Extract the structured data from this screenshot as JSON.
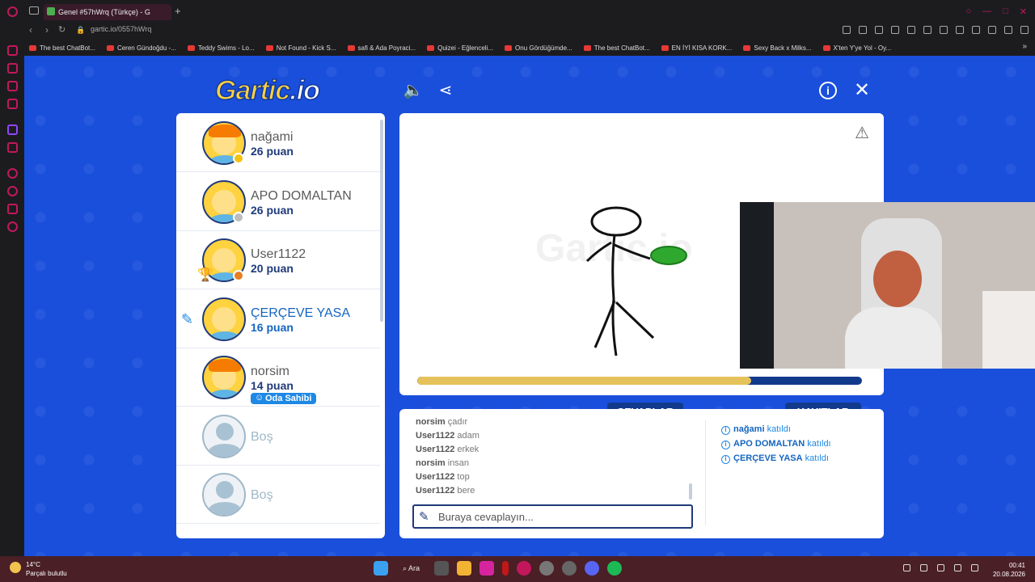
{
  "browser": {
    "tab_title": "Genel #57hWrq (Türkçe) - G",
    "url": "gartic.io/0557hWrq",
    "new_tab": "+",
    "bookmarks": [
      "The best ChatBot...",
      "Ceren Gündoğdu -...",
      "Teddy Swims - Lo...",
      "Not Found - Kick S...",
      "safi & Ada Poyraci...",
      "Quizei - Eğlenceli...",
      "Onu Gördüğümde...",
      "The best ChatBot...",
      "EN İYİ KISA KORK...",
      "Sexy Back x Milks...",
      "X'ten Y'ye Yol - Oy..."
    ]
  },
  "game": {
    "logo": "Gartic",
    "logo_suffix": ".io",
    "players": [
      {
        "name": "nağami",
        "points": "26 puan",
        "dot_color": "#f4c20d"
      },
      {
        "name": "APO DOMALTAN",
        "points": "26 puan",
        "dot_color": "#bdbdbd"
      },
      {
        "name": "User1122",
        "points": "20 puan",
        "dot_color": "#e67e22"
      },
      {
        "name": "ÇERÇEVE YASA",
        "points": "16 puan",
        "drawing": true
      },
      {
        "name": "norsim",
        "points": "14 puan",
        "badge": "Oda Sahibi"
      },
      {
        "name": "Boş",
        "empty": true
      },
      {
        "name": "Boş",
        "empty": true
      }
    ],
    "canvas_watermark": "Gartic.io",
    "timer_progress": 0.75,
    "tabs": {
      "answers": "CEVAPLAR",
      "logs": "KAYITLAR"
    },
    "answers": [
      {
        "user": "norsim",
        "text": "çadır"
      },
      {
        "user": "User1122",
        "text": "adam"
      },
      {
        "user": "User1122",
        "text": "erkek"
      },
      {
        "user": "norsim",
        "text": "insan"
      },
      {
        "user": "User1122",
        "text": "top"
      },
      {
        "user": "User1122",
        "text": "bere"
      }
    ],
    "answer_placeholder": "Buraya cevaplayın...",
    "logs": [
      {
        "name": "nağami",
        "action": "katıldı"
      },
      {
        "name": "APO DOMALTAN",
        "action": "katıldı"
      },
      {
        "name": "ÇERÇEVE YASA",
        "action": "katıldı"
      }
    ]
  },
  "taskbar": {
    "temp": "14°C",
    "weather": "Parçalı bulutlu",
    "search": "Ara",
    "time": "00:41",
    "date": "20.08.2026"
  }
}
